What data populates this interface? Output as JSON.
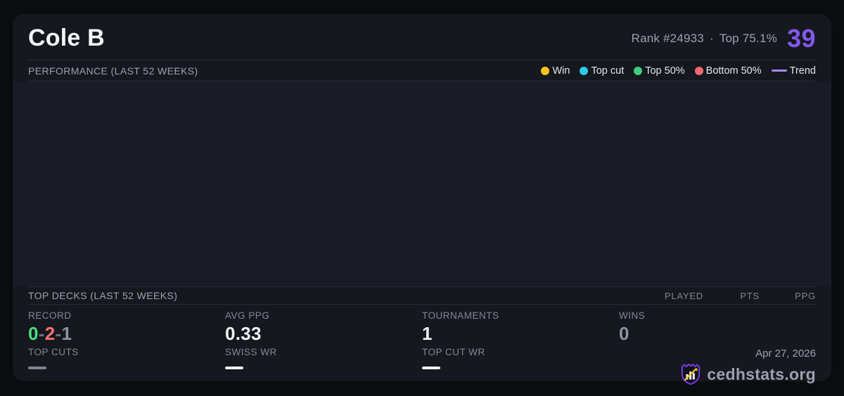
{
  "header": {
    "title": "Cole B",
    "rank_text": "Rank #24933",
    "separator": "·",
    "percentile_text": "Top 75.1%",
    "score": "39"
  },
  "performance": {
    "section_title": "PERFORMANCE (LAST 52 WEEKS)",
    "legend": [
      {
        "label": "Win",
        "color": "#f2c51d",
        "marker": "dot"
      },
      {
        "label": "Top cut",
        "color": "#2fc9e8",
        "marker": "dot"
      },
      {
        "label": "Top 50%",
        "color": "#41cd7c",
        "marker": "dot"
      },
      {
        "label": "Bottom 50%",
        "color": "#f06a6f",
        "marker": "dot"
      },
      {
        "label": "Trend",
        "color": "#a78bfa",
        "marker": "line"
      }
    ],
    "chart_empty": true
  },
  "top_decks": {
    "section_title": "TOP DECKS (LAST 52 WEEKS)",
    "columns": [
      "PLAYED",
      "PTS",
      "PPG"
    ],
    "rows": []
  },
  "stats": {
    "record": {
      "label": "RECORD",
      "wins": "0",
      "losses": "2",
      "draws": "1",
      "separator": "-",
      "colors": {
        "wins": "#4ade80",
        "losses": "#f47174",
        "draws": "#8b93a4"
      }
    },
    "avg_ppg": {
      "label": "AVG PPG",
      "value": "0.33"
    },
    "tournaments": {
      "label": "TOURNAMENTS",
      "value": "1"
    },
    "wins": {
      "label": "WINS",
      "value": "0"
    },
    "top_cuts": {
      "label": "TOP CUTS",
      "value_empty": true
    },
    "swiss_wr": {
      "label": "SWISS WR",
      "value_empty": true
    },
    "top_cut_wr": {
      "label": "TOP CUT WR",
      "value_empty": true
    }
  },
  "footer": {
    "date": "Apr 27, 2026",
    "brand": "cedhstats.org"
  },
  "colors": {
    "accent_purple": "#8259e9",
    "card_background": "#16181f",
    "chart_background": "#1a1c25",
    "page_background": "#0b0c0f"
  }
}
